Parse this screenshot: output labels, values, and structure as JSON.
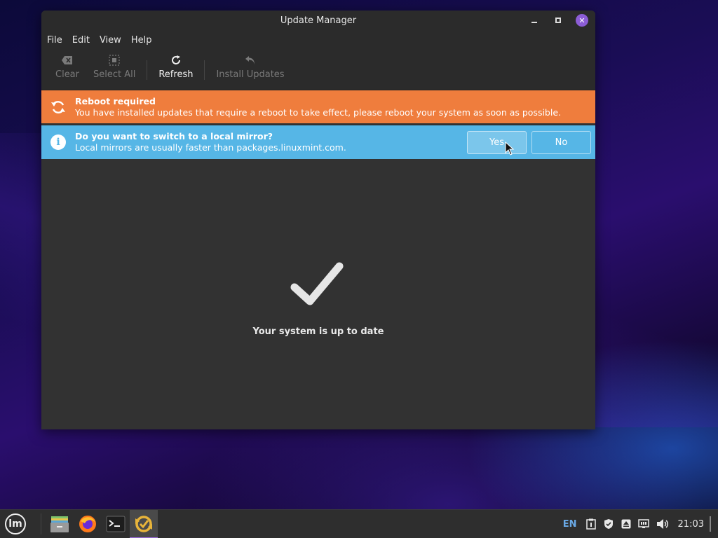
{
  "window": {
    "title": "Update Manager"
  },
  "menubar": {
    "items": [
      {
        "label": "File"
      },
      {
        "label": "Edit"
      },
      {
        "label": "View"
      },
      {
        "label": "Help"
      }
    ]
  },
  "toolbar": {
    "clear_label": "Clear",
    "select_all_label": "Select All",
    "refresh_label": "Refresh",
    "install_updates_label": "Install Updates"
  },
  "reboot_bar": {
    "title": "Reboot required",
    "message": "You have installed updates that require a reboot to take effect, please reboot your system as soon as possible.",
    "color": "#ef7d3d"
  },
  "mirror_bar": {
    "title": "Do you want to switch to a local mirror?",
    "message": "Local mirrors are usually faster than packages.linuxmint.com.",
    "yes_label": "Yes",
    "no_label": "No",
    "color": "#56b6e6"
  },
  "main": {
    "status_text": "Your system is up to date",
    "status_icon": "checkmark-icon"
  },
  "taskbar": {
    "apps": [
      {
        "name": "files-icon"
      },
      {
        "name": "firefox-icon"
      },
      {
        "name": "terminal-icon"
      },
      {
        "name": "update-manager-icon",
        "active": true
      }
    ],
    "language": "EN",
    "clock": "21:03"
  },
  "colors": {
    "accent": "#9b6be0",
    "window_bg": "#323232",
    "toolbar_bg": "#2b2b2b"
  }
}
